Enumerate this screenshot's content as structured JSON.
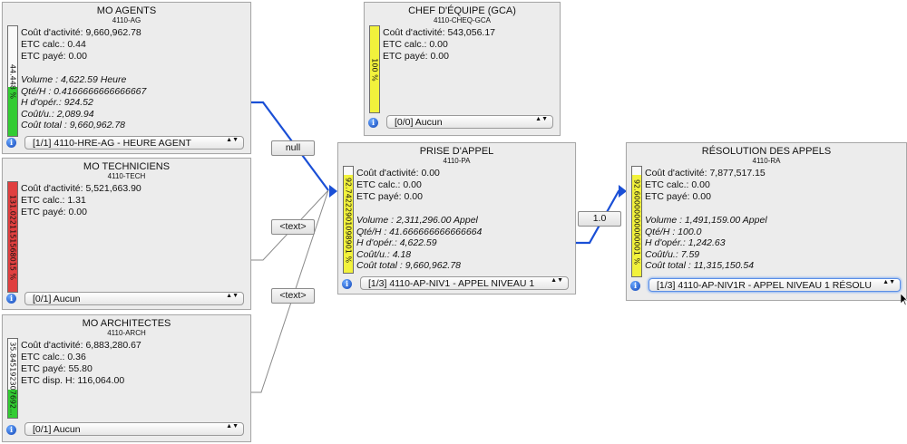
{
  "colors": {
    "gauge_green": "#33cc33",
    "gauge_red": "#e04040",
    "gauge_yellow": "#f2f23c",
    "edge_blue": "#1a4fd6",
    "edge_gray": "#7a7a7a"
  },
  "nodes": {
    "mo_agents": {
      "title": "MO AGENTS",
      "code": "4110-AG",
      "gauge_label": "44.448 %",
      "gauge_fraction": 0.44448,
      "lines": [
        "Coût d'activité: 9,660,962.78",
        "ETC calc.: 0.44",
        "ETC payé: 0.00"
      ],
      "details": [
        "Volume : 4,622.59 Heure",
        "Qté/H : 0.4166666666666667",
        "H d'opér.: 924.52",
        "Coût/u.: 2,089.94",
        "Coût total : 9,660,962.78"
      ],
      "select": "[1/1] 4110-HRE-AG - HEURE AGENT"
    },
    "mo_techniciens": {
      "title": "MO TECHNICIENS",
      "code": "4110-TECH",
      "gauge_label": "131.0221151568015 %",
      "gauge_fraction": 1.0,
      "lines": [
        "Coût d'activité: 5,521,663.90",
        "ETC calc.: 1.31",
        "ETC payé: 0.00"
      ],
      "select": "[0/1] Aucun"
    },
    "mo_architectes": {
      "title": "MO ARCHITECTES",
      "code": "4110-ARCH",
      "gauge_label": "35.845192307692...",
      "gauge_fraction": 0.358,
      "lines": [
        "Coût d'activité: 6,883,280.67",
        "ETC calc.: 0.36",
        "ETC payé: 55.80",
        "ETC disp. H: 116,064.00"
      ],
      "select": "[0/1] Aucun"
    },
    "chef_equipe": {
      "title": "CHEF D'ÉQUIPE (GCA)",
      "code": "4110-CHEQ-GCA",
      "gauge_label": "100 %",
      "gauge_fraction": 1.0,
      "lines": [
        "Coût d'activité: 543,056.17",
        "ETC calc.: 0.00",
        "ETC payé: 0.00"
      ],
      "select": "[0/0] Aucun"
    },
    "prise_appel": {
      "title": "PRISE D'APPEL",
      "code": "4110-PA",
      "gauge_label": "92.74222901098901 %",
      "gauge_fraction": 0.927,
      "lines": [
        "Coût d'activité: 0.00",
        "ETC calc.: 0.00",
        "ETC payé: 0.00"
      ],
      "details": [
        "Volume : 2,311,296.00 Appel",
        "Qté/H : 41.666666666666664",
        "H d'opér.: 4,622.59",
        "Coût/u.: 4.18",
        "Coût total : 9,660,962.78"
      ],
      "select": "[1/3] 4110-AP-NIV1 - APPEL NIVEAU 1"
    },
    "resolution_appels": {
      "title": "RÉSOLUTION DES APPELS",
      "code": "4110-RA",
      "gauge_label": "92.60000000000001 %",
      "gauge_fraction": 0.926,
      "lines": [
        "Coût d'activité: 7,877,517.15",
        "ETC calc.: 0.00",
        "ETC payé: 0.00"
      ],
      "details": [
        "Volume : 1,491,159.00 Appel",
        "Qté/H : 100.0",
        "H d'opér.: 1,242.63",
        "Coût/u.: 7.59",
        "Coût total : 11,315,150.54"
      ],
      "select": "[1/3] 4110-AP-NIV1R - APPEL NIVEAU 1 RÉSOLU"
    }
  },
  "edge_labels": {
    "agents_to_prise": "null",
    "tech_to_prise": "<text>",
    "arch_to_prise": "<text>",
    "prise_to_resolution": "1.0"
  },
  "icons": {
    "info": "info-icon",
    "select_arrows": "up-down-arrows-icon",
    "mouse_cursor": "cursor-icon"
  },
  "info_glyph": "i",
  "select_arrow_glyph": "▲▼"
}
